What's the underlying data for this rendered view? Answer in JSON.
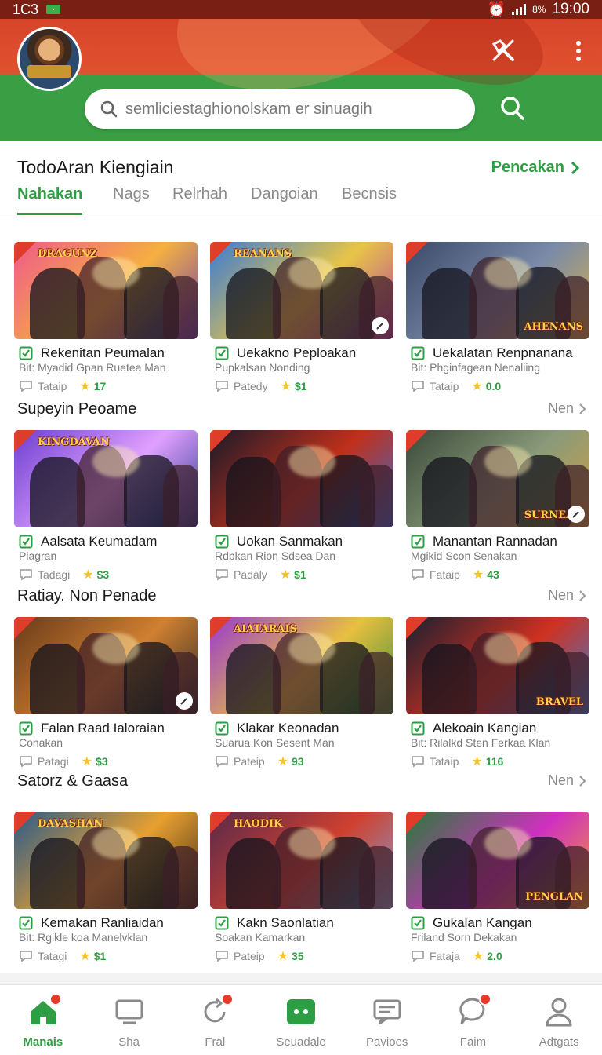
{
  "status_bar": {
    "left_text": "1C3",
    "time": "19:00",
    "battery_text": "8%"
  },
  "header": {
    "search_placeholder": "semliciestaghionolskam er sinuagih"
  },
  "main": {
    "title": "TodoAran Kiengiain",
    "see_all": "Pencakan",
    "tabs": [
      "Nahakan",
      "Nags",
      "Relrhah",
      "Dangoian",
      "Becnsis"
    ]
  },
  "sections": [
    {
      "title": null,
      "more": null,
      "cards": [
        {
          "name": "Rekenitan Peumalan",
          "sub": "Bit: Myadid Gpan Ruetea Man",
          "meta": "Tataip",
          "rating": "17"
        },
        {
          "name": "Uekakno Peploakan",
          "sub": "Pupkalsan Nonding",
          "meta": "Patedy",
          "rating": "$1"
        },
        {
          "name": "Uekalatan Renpnanana",
          "sub": "Bit: Phginfagean Nenaliing",
          "meta": "Tataip",
          "rating": "0.0"
        }
      ]
    },
    {
      "title": "Supeyin Peoame",
      "more": "Nen",
      "cards": [
        {
          "name": "Aalsata Keumadam",
          "sub": "Piagran",
          "meta": "Tadagi",
          "rating": "$3"
        },
        {
          "name": "Uokan Sanmakan",
          "sub": "Rdpkan Rion Sdsea Dan",
          "meta": "Padaly",
          "rating": "$1"
        },
        {
          "name": "Manantan Rannadan",
          "sub": "Mgikid Scon Senakan",
          "meta": "Fataip",
          "rating": "43"
        }
      ]
    },
    {
      "title": "Ratiay. Non Penade",
      "more": "Nen",
      "cards": [
        {
          "name": "Falan Raad Ialoraian",
          "sub": "Conakan",
          "meta": "Patagi",
          "rating": "$3"
        },
        {
          "name": "Klakar Keonadan",
          "sub": "Suarua Kon Sesent Man",
          "meta": "Pateip",
          "rating": "93"
        },
        {
          "name": "Alekoain Kangian",
          "sub": "Bit: Rilalkd Sten Ferkaa Klan",
          "meta": "Tataip",
          "rating": "116"
        }
      ]
    },
    {
      "title": "Satorz & Gaasa",
      "more": "Nen",
      "cards": [
        {
          "name": "Kemakan Ranliaidan",
          "sub": "Bit: Rgikle koa Manelvklan",
          "meta": "Tatagi",
          "rating": "$1"
        },
        {
          "name": "Kakn Saonlatian",
          "sub": "Soakan Kamarkan",
          "meta": "Pateip",
          "rating": "35"
        },
        {
          "name": "Gukalan Kangan",
          "sub": "Friland Sorn Dekakan",
          "meta": "Fataja",
          "rating": "2.0"
        }
      ]
    }
  ],
  "thumb_logos": [
    "DRAGUNZ",
    "REANANS",
    "AHENANS",
    "KINGDAVAN",
    "",
    "SURNEAN",
    "",
    "AIATARAIS",
    "BRAVEL",
    "DAVASHAN",
    "HAODIK",
    "PENGLAN"
  ],
  "bottom_nav": [
    {
      "label": "Manais",
      "icon": "home-icon",
      "active": true,
      "badge": true
    },
    {
      "label": "Sha",
      "icon": "tv-icon",
      "active": false,
      "badge": false
    },
    {
      "label": "Fral",
      "icon": "refresh-icon",
      "active": false,
      "badge": true
    },
    {
      "label": "Seuadale",
      "icon": "chat-box-icon",
      "active": false,
      "badge": false
    },
    {
      "label": "Pavioes",
      "icon": "message-icon",
      "active": false,
      "badge": false
    },
    {
      "label": "Faim",
      "icon": "bubble-icon",
      "active": false,
      "badge": true
    },
    {
      "label": "Adtgats",
      "icon": "profile-icon",
      "active": false,
      "badge": false
    }
  ],
  "colors": {
    "accent": "#2e9e44",
    "header_red": "#d8452a",
    "badge_red": "#e53a2a",
    "star": "#f4c430"
  }
}
